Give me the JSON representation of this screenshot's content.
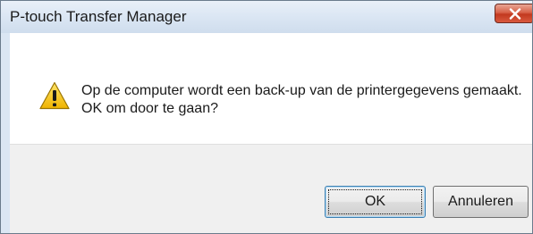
{
  "window": {
    "title": "P-touch Transfer Manager"
  },
  "dialog": {
    "icon": "warning-icon",
    "message_line1": "Op de computer wordt een back-up van de printergegevens gemaakt.",
    "message_line2": "OK om door te gaan?"
  },
  "buttons": {
    "ok_label": "OK",
    "cancel_label": "Annuleren"
  },
  "colors": {
    "close_button": "#c7422b",
    "warning_fill": "#f5c518",
    "title_bar": "#dbe6f3"
  }
}
